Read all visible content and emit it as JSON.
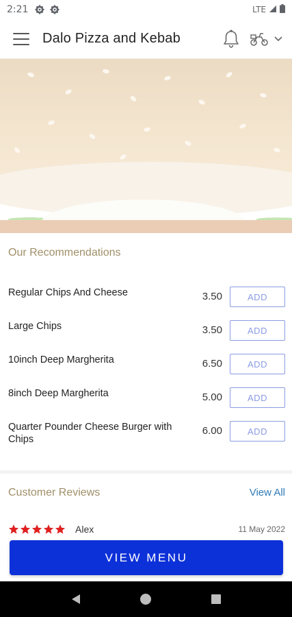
{
  "status_bar": {
    "time": "2:21",
    "network": "LTE",
    "icons": [
      "settings-icon",
      "settings-icon",
      "signal-icon",
      "battery-icon"
    ]
  },
  "header": {
    "title": "Dalo Pizza and Kebab",
    "icons": [
      "menu-icon",
      "bell-icon",
      "delivery-scooter-icon",
      "chevron-down-icon"
    ]
  },
  "recommendations": {
    "title": "Our Recommendations",
    "add_label": "ADD",
    "items": [
      {
        "name": "Regular Chips And Cheese",
        "price": "3.50"
      },
      {
        "name": "Large Chips",
        "price": "3.50"
      },
      {
        "name": "10inch Deep Margherita",
        "price": "6.50"
      },
      {
        "name": "8inch Deep Margherita",
        "price": "5.00"
      },
      {
        "name": "Quarter Pounder Cheese Burger with Chips",
        "price": "6.00"
      }
    ]
  },
  "reviews": {
    "title": "Customer Reviews",
    "view_all": "View All",
    "items": [
      {
        "rating": 5,
        "author": "Alex",
        "date": "11 May 2022"
      }
    ]
  },
  "cta": {
    "label": "VIEW MENU"
  },
  "nav": {
    "icons": [
      "back-icon",
      "home-icon",
      "recents-icon"
    ]
  },
  "colors": {
    "accent_gold": "#a08f68",
    "cta_blue": "#0d31d8",
    "add_outline": "#8a9be3",
    "link_blue": "#2f7ab7",
    "star_red": "#e02020"
  }
}
